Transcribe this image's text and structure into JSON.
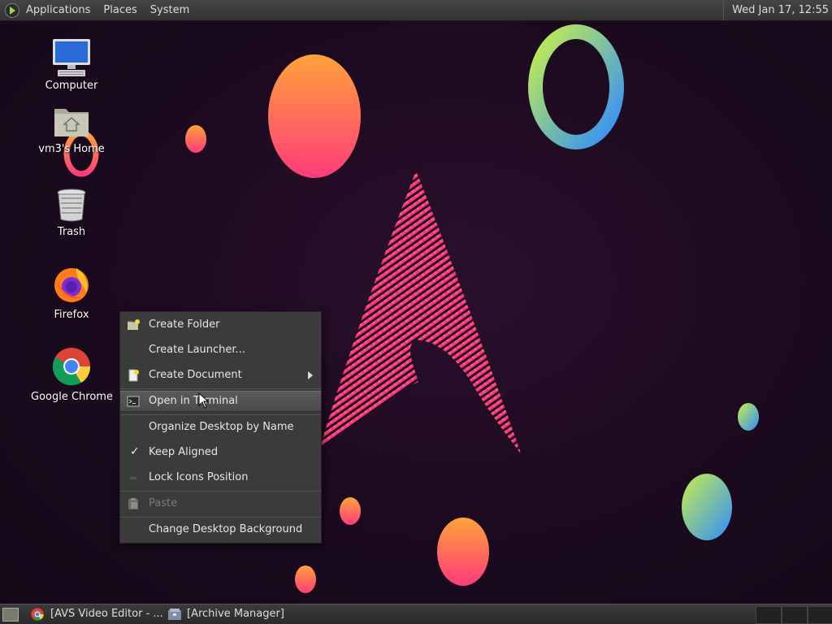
{
  "topbar": {
    "menus": [
      "Applications",
      "Places",
      "System"
    ],
    "clock": "Wed Jan 17, 12:55"
  },
  "desktop": {
    "icons": [
      {
        "label": "Computer",
        "icon": "computer-icon"
      },
      {
        "label": "vm3's Home",
        "icon": "home-folder-icon"
      },
      {
        "label": "Trash",
        "icon": "trash-icon"
      },
      {
        "label": "Firefox",
        "icon": "firefox-icon"
      },
      {
        "label": "Google Chrome",
        "icon": "chrome-icon"
      }
    ]
  },
  "context_menu": {
    "items": [
      {
        "label": "Create Folder",
        "icon": "folder-new-icon"
      },
      {
        "label": "Create Launcher..."
      },
      {
        "label": "Create Document",
        "icon": "document-new-icon",
        "submenu": true
      },
      {
        "label": "Open in Terminal",
        "icon": "terminal-icon",
        "highlighted": true
      },
      {
        "label": "Organize Desktop by Name"
      },
      {
        "label": "Keep Aligned",
        "checked": true
      },
      {
        "label": "Lock Icons Position"
      },
      {
        "label": "Paste",
        "icon": "paste-icon",
        "disabled": true
      },
      {
        "label": "Change Desktop Background"
      }
    ]
  },
  "taskbar": {
    "tasks": [
      {
        "label": "[AVS Video Editor - ...",
        "icon": "chrome-icon"
      },
      {
        "label": "[Archive Manager]",
        "icon": "archive-manager-icon"
      }
    ]
  },
  "colors": {
    "panel": "#333333",
    "menu_bg": "#3b3b3b",
    "accent_pink": "#ff2d8a",
    "accent_orange": "#ffa040"
  }
}
